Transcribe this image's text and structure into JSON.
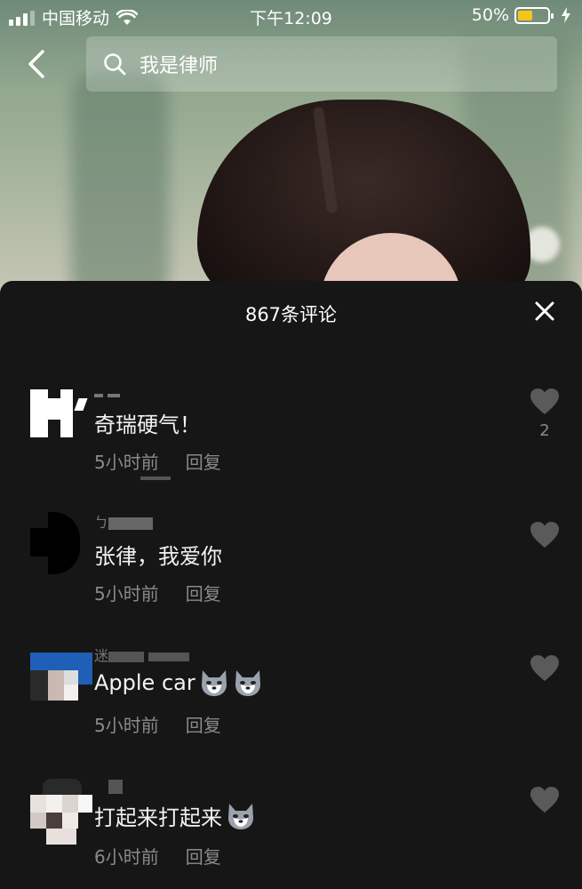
{
  "status_bar": {
    "carrier": "中国移动",
    "time": "下午12:09",
    "battery": "50%",
    "battery_level": 0.5,
    "battery_color": "#f5c518"
  },
  "nav": {
    "back_icon": "chevron-left-icon",
    "search_icon": "search-icon",
    "search_text": "我是律师"
  },
  "comments_panel": {
    "title": "867条评论",
    "close_icon": "close-icon",
    "comments": [
      {
        "text": "奇瑞硬气！",
        "time": "5小时前",
        "reply": "回复",
        "likes": "2",
        "emoji_count": 0
      },
      {
        "text": "张律，我爱你",
        "time": "5小时前",
        "reply": "回复",
        "likes": "",
        "emoji_count": 0
      },
      {
        "text": "Apple car",
        "time": "5小时前",
        "reply": "回复",
        "likes": "",
        "emoji_count": 2
      },
      {
        "text": "打起来打起来",
        "time": "6小时前",
        "reply": "回复",
        "likes": "",
        "emoji_count": 1
      }
    ]
  }
}
